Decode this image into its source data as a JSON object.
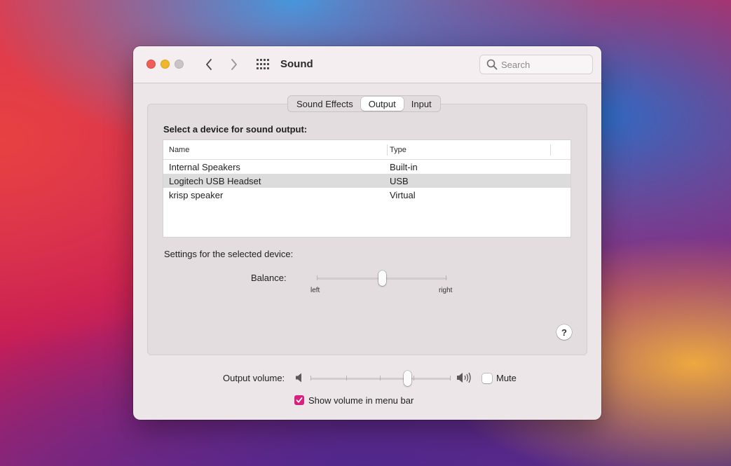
{
  "window": {
    "title": "Sound",
    "search": {
      "placeholder": "Search",
      "value": ""
    }
  },
  "tabs": [
    {
      "label": "Sound Effects",
      "active": false
    },
    {
      "label": "Output",
      "active": true
    },
    {
      "label": "Input",
      "active": false
    }
  ],
  "output": {
    "select_label": "Select a device for sound output:",
    "columns": {
      "name": "Name",
      "type": "Type"
    },
    "devices": [
      {
        "name": "Internal Speakers",
        "type": "Built-in",
        "selected": false
      },
      {
        "name": "Logitech USB Headset",
        "type": "USB",
        "selected": true
      },
      {
        "name": "krisp speaker",
        "type": "Virtual",
        "selected": false
      }
    ],
    "settings_label": "Settings for the selected device:",
    "balance": {
      "label": "Balance:",
      "left_label": "left",
      "right_label": "right",
      "value": 0.5
    }
  },
  "volume": {
    "label": "Output volume:",
    "value": 0.69,
    "mute_label": "Mute",
    "muted": false,
    "show_in_menu_bar_label": "Show volume in menu bar",
    "show_in_menu_bar": true
  },
  "help_label": "?",
  "colors": {
    "accent": "#d6217f",
    "close": "#ed5f57",
    "minimize": "#f0b72b",
    "zoom_inactive": "#c9c5c6",
    "selected_row": "#dcdcdc"
  },
  "icons": [
    "back-chevron-icon",
    "forward-chevron-icon",
    "grid-icon",
    "search-icon",
    "speaker-low-icon",
    "speaker-high-icon",
    "checkmark-icon"
  ]
}
